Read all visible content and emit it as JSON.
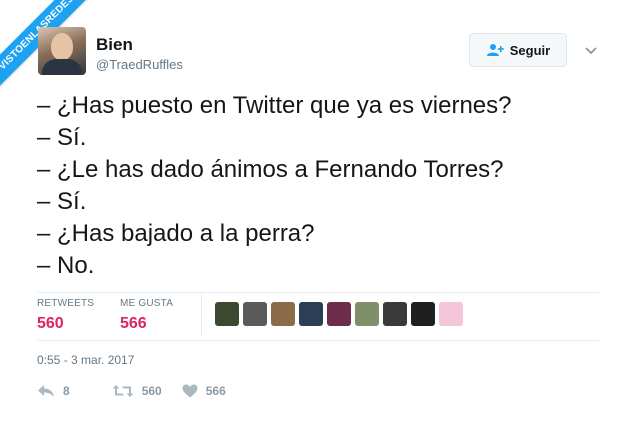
{
  "watermark": "VISTOENLASREDES",
  "author": {
    "name": "Bien",
    "handle": "@TraedRuffles"
  },
  "follow_label": "Seguir",
  "tweet_lines": [
    "– ¿Has puesto en Twitter que ya es viernes?",
    "– Sí.",
    "– ¿Le has dado ánimos a Fernando Torres?",
    "– Sí.",
    "– ¿Has bajado a la perra?",
    "– No."
  ],
  "stats": {
    "retweets_label": "RETWEETS",
    "retweets": "560",
    "likes_label": "ME GUSTA",
    "likes": "566"
  },
  "liker_avatar_colors": [
    "#3b4a2f",
    "#5a5a5a",
    "#8a6b4a",
    "#2c3e55",
    "#6b2d4a",
    "#7f8f6a",
    "#3a3a3a",
    "#1f1f1f",
    "#f3c6d9"
  ],
  "timestamp": "0:55 - 3 mar. 2017",
  "actions": {
    "replies": "8",
    "retweets": "560",
    "likes": "566"
  },
  "colors": {
    "accent": "#1da1f2",
    "like": "#e0245e",
    "muted": "#657786"
  }
}
